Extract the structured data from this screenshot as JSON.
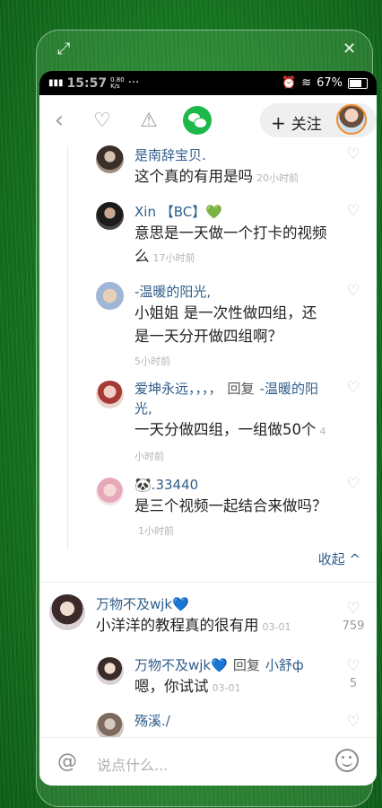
{
  "status": {
    "time": "15:57",
    "speed": "0.80",
    "speed_unit": "K/s",
    "dots": "···",
    "battery": "67%"
  },
  "toolbar": {
    "follow_plus": "+",
    "follow_label": "关注"
  },
  "replies": [
    {
      "user": "是南辞宝贝.",
      "text": "这个真的有用是吗",
      "time": "20小时前"
    },
    {
      "user": "Xin 【BC】💚",
      "text": "意思是一天做一个打卡的视频么",
      "time": "17小时前"
    },
    {
      "user": "-温暖的阳光,",
      "text": "小姐姐 是一次性做四组，还是一天分开做四组啊？",
      "time": "5小时前"
    },
    {
      "user": "爱坤永远，，，，",
      "reply_word": "回复",
      "reply_to": "-温暖的阳光,",
      "text": "一天分做四组，一组做50个",
      "time": "4小时前"
    },
    {
      "user": "🐼.33440",
      "text": "是三个视频一起结合来做吗？",
      "time": "1小时前"
    }
  ],
  "collapse_label": "收起 ^",
  "comments": [
    {
      "user": "万物不及wjk💙",
      "text": "小洋洋的教程真的很有用",
      "time": "03-01",
      "likes": "759"
    },
    {
      "user": "万物不及wjk💙",
      "reply_word": "回复",
      "reply_to": "小舒ф",
      "text": "嗯，你试试",
      "time": "03-01",
      "likes": "5"
    },
    {
      "user": "殇溪./"
    }
  ],
  "input": {
    "placeholder": "说点什么..."
  }
}
